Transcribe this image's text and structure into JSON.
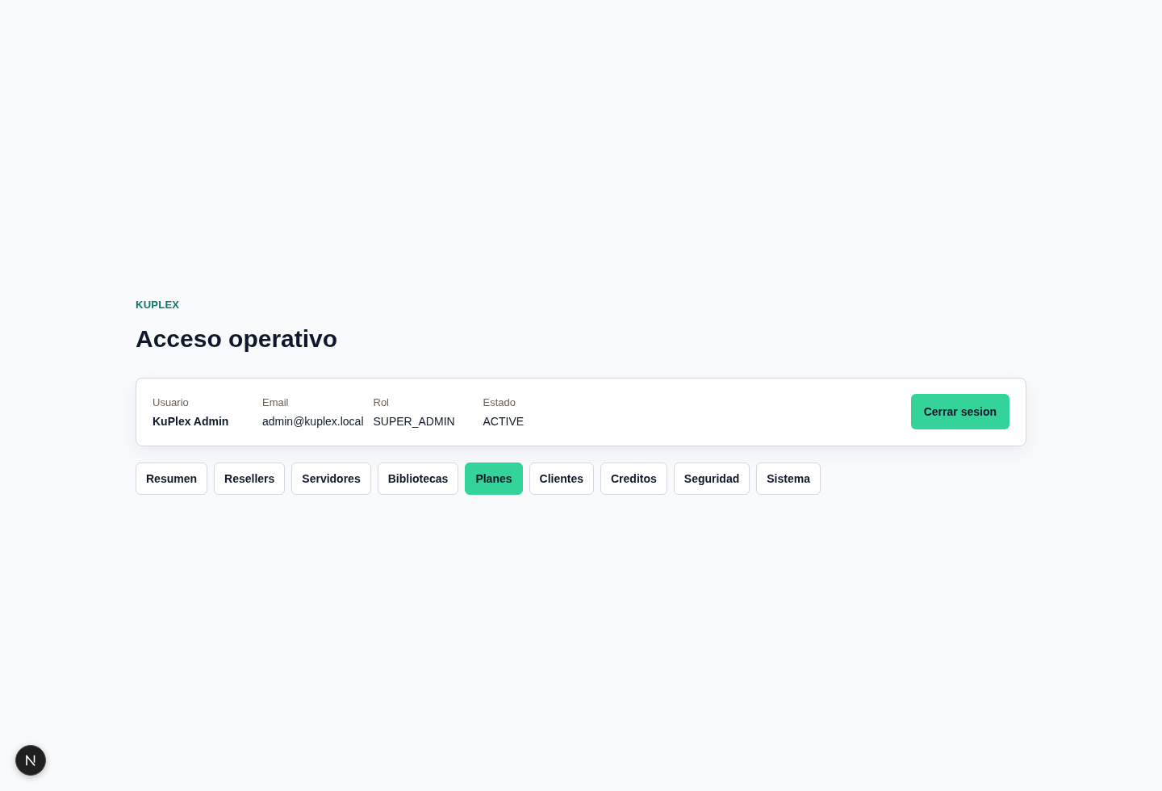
{
  "brand": "KUPLEX",
  "title": "Acceso operativo",
  "session": {
    "fields": [
      {
        "label": "Usuario",
        "value": "KuPlex Admin",
        "kind": "name"
      },
      {
        "label": "Email",
        "value": "admin@kuplex.local",
        "kind": "text"
      },
      {
        "label": "Rol",
        "value": "SUPER_ADMIN",
        "kind": "text"
      },
      {
        "label": "Estado",
        "value": "ACTIVE",
        "kind": "text"
      }
    ],
    "logout_button": "Cerrar sesion"
  },
  "tabs": [
    {
      "label": "Resumen",
      "selected": false
    },
    {
      "label": "Resellers",
      "selected": false
    },
    {
      "label": "Servidores",
      "selected": false
    },
    {
      "label": "Bibliotecas",
      "selected": false
    },
    {
      "label": "Planes",
      "selected": true
    },
    {
      "label": "Clientes",
      "selected": false
    },
    {
      "label": "Creditos",
      "selected": false
    },
    {
      "label": "Seguridad",
      "selected": false
    },
    {
      "label": "Sistema",
      "selected": false
    }
  ]
}
